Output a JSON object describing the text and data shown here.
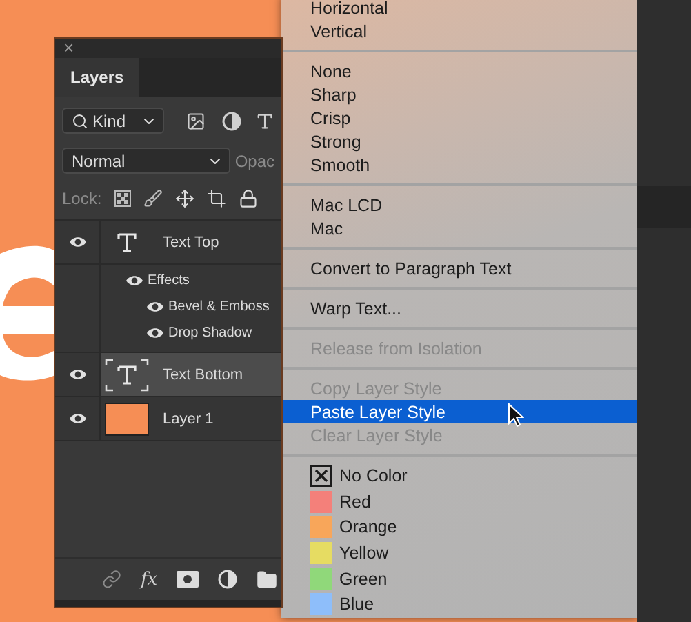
{
  "panel": {
    "close": "×",
    "tabs": [
      {
        "label": "Layers",
        "selected": true
      }
    ],
    "filter": {
      "value": "Kind"
    },
    "blend_mode": {
      "value": "Normal"
    },
    "opacity_label": "Opac",
    "lock_label": "Lock:",
    "layers": [
      {
        "kind": "text",
        "name": "Text Top",
        "visible": true,
        "selected": false,
        "effects": {
          "label": "Effects",
          "visible": true,
          "children": [
            {
              "label": "Bevel & Emboss",
              "visible": true
            },
            {
              "label": "Drop Shadow",
              "visible": true
            }
          ]
        }
      },
      {
        "kind": "text",
        "name": "Text Bottom",
        "visible": true,
        "selected": true
      },
      {
        "kind": "fill",
        "name": "Layer 1",
        "visible": true,
        "selected": false,
        "color": "#f68e55"
      }
    ],
    "footer": {
      "fx": "fx"
    }
  },
  "menu": {
    "items": [
      {
        "kind": "item",
        "label": "Horizontal",
        "disabled": false,
        "selected": false
      },
      {
        "kind": "item",
        "label": "Vertical",
        "disabled": false,
        "selected": false
      },
      {
        "kind": "separator"
      },
      {
        "kind": "item",
        "label": "None",
        "disabled": false,
        "selected": false
      },
      {
        "kind": "item",
        "label": "Sharp",
        "disabled": false,
        "selected": false
      },
      {
        "kind": "item",
        "label": "Crisp",
        "disabled": false,
        "selected": false
      },
      {
        "kind": "item",
        "label": "Strong",
        "disabled": false,
        "selected": false
      },
      {
        "kind": "item",
        "label": "Smooth",
        "disabled": false,
        "selected": false
      },
      {
        "kind": "separator"
      },
      {
        "kind": "item",
        "label": "Mac LCD",
        "disabled": false,
        "selected": false
      },
      {
        "kind": "item",
        "label": "Mac",
        "disabled": false,
        "selected": false
      },
      {
        "kind": "separator"
      },
      {
        "kind": "item",
        "label": "Convert to Paragraph Text",
        "disabled": false,
        "selected": false
      },
      {
        "kind": "separator"
      },
      {
        "kind": "item",
        "label": "Warp Text...",
        "disabled": false,
        "selected": false
      },
      {
        "kind": "separator"
      },
      {
        "kind": "item",
        "label": "Release from Isolation",
        "disabled": true,
        "selected": false
      },
      {
        "kind": "separator"
      },
      {
        "kind": "item",
        "label": "Copy Layer Style",
        "disabled": true,
        "selected": false
      },
      {
        "kind": "item",
        "label": "Paste Layer Style",
        "disabled": false,
        "selected": true
      },
      {
        "kind": "item",
        "label": "Clear Layer Style",
        "disabled": true,
        "selected": false
      },
      {
        "kind": "separator"
      },
      {
        "kind": "nocolor",
        "label": "No Color",
        "disabled": false,
        "selected": false
      },
      {
        "kind": "color",
        "label": "Red",
        "color": "#f4807a",
        "disabled": false,
        "selected": false
      },
      {
        "kind": "color",
        "label": "Orange",
        "color": "#f8a65a",
        "disabled": false,
        "selected": false
      },
      {
        "kind": "color",
        "label": "Yellow",
        "color": "#e6dc62",
        "disabled": false,
        "selected": false
      },
      {
        "kind": "color",
        "label": "Green",
        "color": "#90d87a",
        "disabled": false,
        "selected": false
      },
      {
        "kind": "color",
        "label": "Blue",
        "color": "#8ebefa",
        "disabled": false,
        "selected": false
      }
    ]
  }
}
